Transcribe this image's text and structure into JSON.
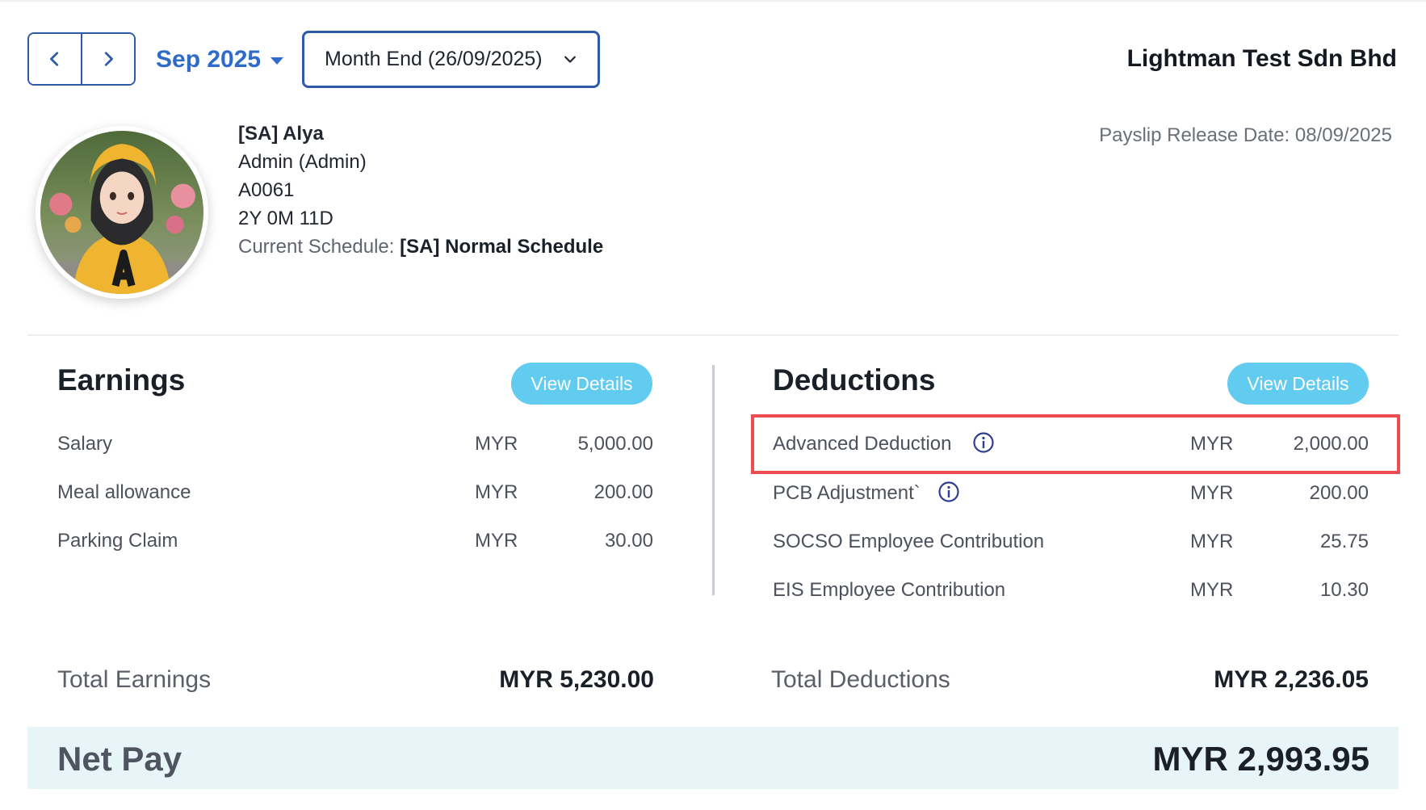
{
  "header": {
    "prev_label": "previous-month",
    "next_label": "next-month",
    "month": "Sep 2025",
    "period": "Month End (26/09/2025)",
    "company": "Lightman Test Sdn Bhd"
  },
  "employee": {
    "name": "[SA] Alya",
    "role": "Admin (Admin)",
    "id": "A0061",
    "tenure": "2Y 0M 11D",
    "schedule_label": "Current Schedule:",
    "schedule_value": "[SA] Normal Schedule"
  },
  "release": {
    "text": "Payslip Release Date: 08/09/2025"
  },
  "earnings": {
    "title": "Earnings",
    "view_label": "View Details",
    "items": [
      {
        "label": "Salary",
        "currency": "MYR",
        "amount": "5,000.00"
      },
      {
        "label": "Meal allowance",
        "currency": "MYR",
        "amount": "200.00"
      },
      {
        "label": "Parking Claim",
        "currency": "MYR",
        "amount": "30.00"
      }
    ],
    "total_label": "Total Earnings",
    "total_value": "MYR 5,230.00"
  },
  "deductions": {
    "title": "Deductions",
    "view_label": "View Details",
    "items": [
      {
        "label": "Advanced Deduction",
        "currency": "MYR",
        "amount": "2,000.00",
        "info": true,
        "highlighted": true
      },
      {
        "label": "PCB Adjustment`",
        "currency": "MYR",
        "amount": "200.00",
        "info": true
      },
      {
        "label": "SOCSO Employee Contribution",
        "currency": "MYR",
        "amount": "25.75"
      },
      {
        "label": "EIS Employee Contribution",
        "currency": "MYR",
        "amount": "10.30"
      }
    ],
    "total_label": "Total Deductions",
    "total_value": "MYR 2,236.05"
  },
  "net_pay": {
    "label": "Net Pay",
    "value": "MYR 2,993.95"
  },
  "colors": {
    "accent": "#2f6bc8",
    "button": "#62cbf0",
    "highlight": "#ee4c50",
    "net_bg": "#e7f5f8"
  },
  "icons": [
    "chevron-left-icon",
    "chevron-right-icon",
    "caret-down-icon",
    "chevron-down-icon",
    "info-icon"
  ]
}
